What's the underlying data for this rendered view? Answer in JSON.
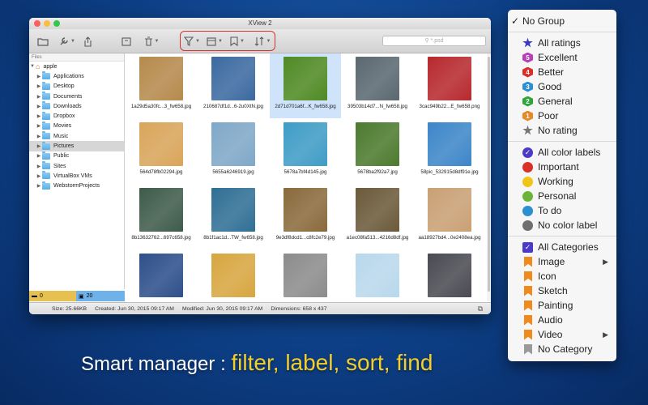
{
  "window": {
    "title": "XView 2",
    "search": {
      "placeholder": "*.psd"
    },
    "toolbar": [
      {
        "name": "folder-icon"
      },
      {
        "name": "wrench-icon"
      },
      {
        "name": "share-icon"
      },
      {
        "name": "archive-icon"
      },
      {
        "name": "trash-icon"
      },
      {
        "name": "filter-icon"
      },
      {
        "name": "calendar-icon"
      },
      {
        "name": "bookmark-icon"
      },
      {
        "name": "sort-icon"
      }
    ],
    "sidebar": {
      "header": "Files",
      "root": "apple",
      "items": [
        "Applications",
        "Desktop",
        "Documents",
        "Downloads",
        "Dropbox",
        "Movies",
        "Music",
        "Pictures",
        "Public",
        "Sites",
        "VirtualBox VMs",
        "WebstormProjects"
      ],
      "selected": "Pictures",
      "footer": {
        "count_a": "0",
        "count_b": "20"
      }
    },
    "files": [
      {
        "name": "1a29d5a30fc...3_fw658.jpg",
        "color": "#b58a4c"
      },
      {
        "name": "210687df1d...6-2u0XtN.jpg",
        "color": "#3b6aa0"
      },
      {
        "name": "2d71d701a6f...K_fw658.jpg",
        "color": "#4f8a24"
      },
      {
        "name": "39503b14d7...N_fw658.jpg",
        "color": "#5a6870"
      },
      {
        "name": "3cac949b22...E_fw658.png",
        "color": "#b7292e"
      },
      {
        "name": "564d78fb02294.jpg",
        "color": "#d9a55a"
      },
      {
        "name": "5655a6246919.jpg",
        "color": "#7fa8c8"
      },
      {
        "name": "5678a7bf4d145.jpg",
        "color": "#3f9cc6"
      },
      {
        "name": "5678ba2f92a7.jpg",
        "color": "#4c7a2e"
      },
      {
        "name": "58pic_532915d8df91e.jpg",
        "color": "#3d86c9"
      },
      {
        "name": "8b13632762...697c658.jpg",
        "color": "#3e5b4a"
      },
      {
        "name": "8b1f1ac1d...TW_fw658.jpg",
        "color": "#2f6f95"
      },
      {
        "name": "9e3df8dcd1...c8fc2e79.jpg",
        "color": "#8a6a3c"
      },
      {
        "name": "a1ec08fa513...4216d8df.jpg",
        "color": "#6b5a3a"
      },
      {
        "name": "aa18927bd4...0e2408ea.jpg",
        "color": "#c9a074"
      },
      {
        "name": "",
        "color": "#2d4f8a"
      },
      {
        "name": "",
        "color": "#d7a640"
      },
      {
        "name": "",
        "color": "#8c8c8c"
      },
      {
        "name": "",
        "color": "#b9d8ec"
      },
      {
        "name": "",
        "color": "#4a4a52"
      }
    ],
    "selected_file": "2d71d701a6f...K_fw658.jpg",
    "status": {
      "size": "Size: 25.66KB",
      "created": "Created: Jun 30, 2015 09:17 AM",
      "modified": "Modified: Jun 30, 2015 09:17 AM",
      "dimensions": "Dimensions: 658 x 437"
    }
  },
  "menu": {
    "items": [
      {
        "label": "No Group",
        "checked": true,
        "icon": "none"
      },
      {
        "sep": true
      },
      {
        "label": "All ratings",
        "icon": "star",
        "color": "#3a3ac6",
        "mark": ""
      },
      {
        "label": "Excellent",
        "icon": "badge",
        "color": "#b540b8",
        "mark": "5"
      },
      {
        "label": "Better",
        "icon": "badge",
        "color": "#d9302a",
        "mark": "4"
      },
      {
        "label": "Good",
        "icon": "badge",
        "color": "#2b8fd0",
        "mark": "3"
      },
      {
        "label": "General",
        "icon": "badge",
        "color": "#30a63a",
        "mark": "2"
      },
      {
        "label": "Poor",
        "icon": "badge",
        "color": "#e58a2a",
        "mark": "1"
      },
      {
        "label": "No rating",
        "icon": "star",
        "color": "#777777",
        "mark": ""
      },
      {
        "sep": true
      },
      {
        "label": "All color labels",
        "icon": "check-dot",
        "color": "#4a3ac6"
      },
      {
        "label": "Important",
        "icon": "dot",
        "color": "#d9302a"
      },
      {
        "label": "Working",
        "icon": "dot",
        "color": "#f0c419"
      },
      {
        "label": "Personal",
        "icon": "dot",
        "color": "#6bb536"
      },
      {
        "label": "To do",
        "icon": "dot",
        "color": "#2b8fd0"
      },
      {
        "label": "No color label",
        "icon": "dot",
        "color": "#6f6f6f"
      },
      {
        "sep": true
      },
      {
        "label": "All Categories",
        "icon": "check-box",
        "color": "#4a3ac6"
      },
      {
        "label": "Image",
        "icon": "bookmark",
        "color": "#f08a1c",
        "submenu": true
      },
      {
        "label": "Icon",
        "icon": "bookmark",
        "color": "#f08a1c"
      },
      {
        "label": "Sketch",
        "icon": "bookmark",
        "color": "#f08a1c"
      },
      {
        "label": "Painting",
        "icon": "bookmark",
        "color": "#f08a1c"
      },
      {
        "label": "Audio",
        "icon": "bookmark",
        "color": "#f08a1c"
      },
      {
        "label": "Video",
        "icon": "bookmark",
        "color": "#f08a1c",
        "submenu": true
      },
      {
        "label": "No Category",
        "icon": "bookmark",
        "color": "#9a9a9a"
      }
    ]
  },
  "caption": {
    "prefix": "Smart manager : ",
    "highlight": "filter, label, sort, find"
  }
}
